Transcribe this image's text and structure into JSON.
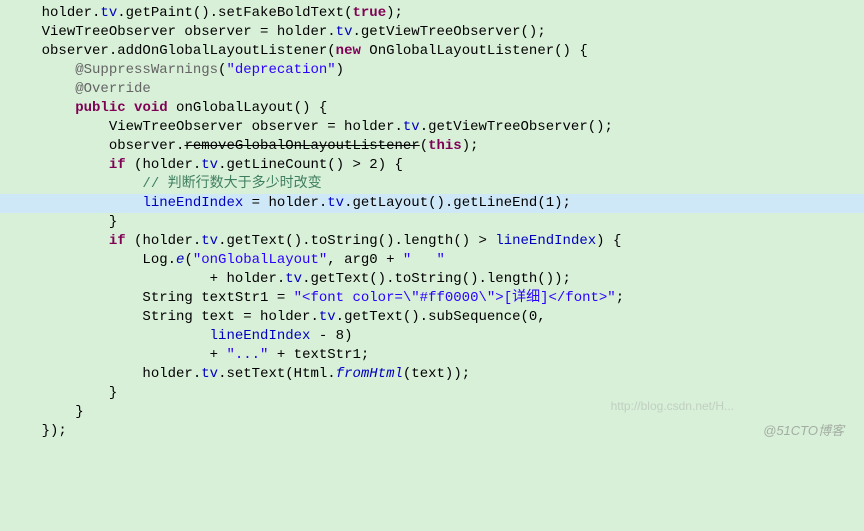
{
  "code": {
    "l1a": "holder.",
    "l1b": "tv",
    "l1c": ".getPaint().setFakeBoldText(",
    "l1d": "true",
    "l1e": ");",
    "l2a": "ViewTreeObserver observer = holder.",
    "l2b": "tv",
    "l2c": ".getViewTreeObserver();",
    "l3a": "observer.addOnGlobalLayoutListener(",
    "l3b": "new",
    "l3c": " OnGlobalLayoutListener() {",
    "l4": "",
    "l5a": "    @SuppressWarnings",
    "l5b": "(",
    "l5c": "\"deprecation\"",
    "l5d": ")",
    "l6a": "    @Override",
    "l7a": "    ",
    "l7b": "public",
    "l7c": " ",
    "l7d": "void",
    "l7e": " onGlobalLayout() {",
    "l8a": "        ViewTreeObserver observer = holder.",
    "l8b": "tv",
    "l8c": ".getViewTreeObserver();",
    "l9a": "        observer.",
    "l9b": "removeGlobalOnLayoutListener",
    "l9c": "(",
    "l9d": "this",
    "l9e": ");",
    "l10a": "        ",
    "l10b": "if",
    "l10c": " (holder.",
    "l10d": "tv",
    "l10e": ".getLineCount() > 2) {",
    "l11a": "            // 判断行数大于多少时改变",
    "l12a": "            ",
    "l12b": "lineEndIndex",
    "l12c": " = holder.",
    "l12d": "tv",
    "l12e": ".getLayout().getLineEnd(1);",
    "l13a": "        }",
    "l14a": "        ",
    "l14b": "if",
    "l14c": " (holder.",
    "l14d": "tv",
    "l14e": ".getText().toString().length() > ",
    "l14f": "lineEndIndex",
    "l14g": ") {",
    "l15a": "            Log.",
    "l15b": "e",
    "l15c": "(",
    "l15d": "\"onGlobalLayout\"",
    "l15e": ", arg0 + ",
    "l15f": "\"   \"",
    "l16a": "                    + holder.",
    "l16b": "tv",
    "l16c": ".getText().toString().length());",
    "l17a": "            String textStr1 = ",
    "l17b": "\"<font color=\\\"#ff0000\\\">[详细]</font>\"",
    "l17c": ";",
    "l18a": "            String text = holder.",
    "l18b": "tv",
    "l18c": ".getText().subSequence(0,",
    "l19a": "                    ",
    "l19b": "lineEndIndex",
    "l19c": " - 8)",
    "l20a": "                    + ",
    "l20b": "\"...\"",
    "l20c": " + textStr1;",
    "l21a": "            holder.",
    "l21b": "tv",
    "l21c": ".setText(Html.",
    "l21d": "fromHtml",
    "l21e": "(text));",
    "l22a": "        }",
    "l23a": "    }",
    "l24a": "});"
  },
  "watermark": "@51CTO博客",
  "watermark2": "http://blog.csdn.net/H..."
}
